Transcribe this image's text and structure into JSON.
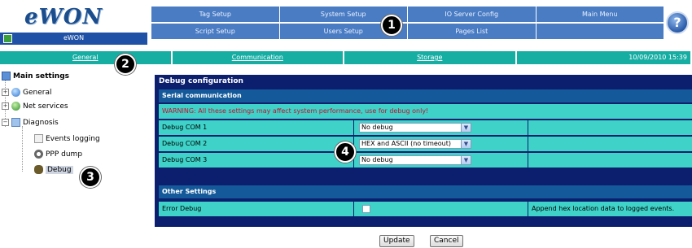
{
  "app": {
    "logo": "eWON",
    "site_name": "eWON"
  },
  "topnav": {
    "row1": [
      "Tag Setup",
      "System Setup",
      "IO Server Config",
      "Main Menu"
    ],
    "row2": [
      "Script Setup",
      "Users Setup",
      "Pages List",
      ""
    ]
  },
  "help_label": "?",
  "subnav": {
    "items": [
      "General",
      "Communication",
      "Storage"
    ],
    "datetime": "10/09/2010 15:39"
  },
  "sidebar": {
    "root": "Main settings",
    "general": "General",
    "net_services": "Net services",
    "diagnosis": "Diagnosis",
    "events_logging": "Events logging",
    "ppp_dump": "PPP dump",
    "debug": "Debug"
  },
  "panel": {
    "title": "Debug configuration",
    "serial_header": "Serial communication",
    "warning": "WARNING: All these settings may affect system performance, use for debug only!",
    "com_rows": [
      {
        "label": "Debug COM 1",
        "value": "No debug"
      },
      {
        "label": "Debug COM 2",
        "value": "HEX and ASCII (no timeout)"
      },
      {
        "label": "Debug COM 3",
        "value": "No debug"
      }
    ],
    "other_header": "Other Settings",
    "error_debug_label": "Error Debug",
    "error_debug_desc": "Append hex location data to logged events."
  },
  "buttons": {
    "update": "Update",
    "cancel": "Cancel"
  },
  "callouts": [
    "1",
    "2",
    "3",
    "4"
  ],
  "colors": {
    "topnav": "#4a7cc3",
    "subnav": "#16ada3",
    "panel": "#0b1f6e",
    "row": "#3ed2c8",
    "warning": "#c8102e"
  }
}
